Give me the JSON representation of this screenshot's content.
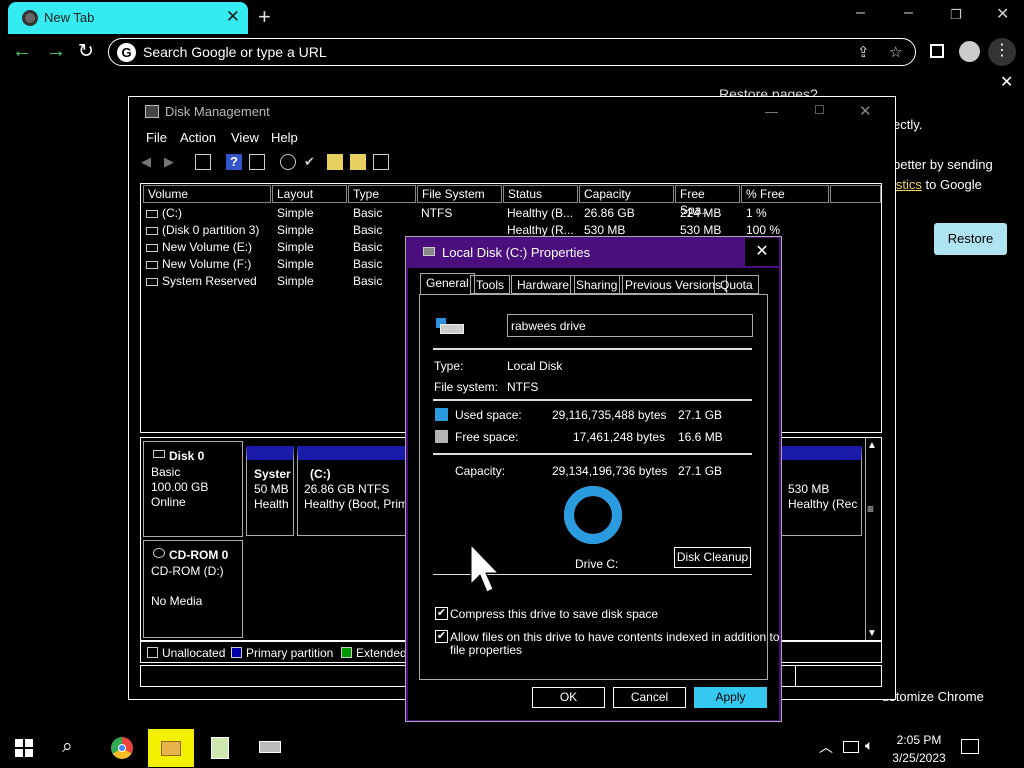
{
  "browser": {
    "tab_title": "New Tab",
    "omnibox_placeholder": "Search Google or type a URL",
    "win_min": "–",
    "win_restore": "❐",
    "win_close": "✕"
  },
  "restore_bubble": {
    "title": "Restore pages?",
    "line1": "ectly.",
    "line2": "better by sending",
    "line3_link": "istics",
    "line3_rest": " to Google",
    "button": "Restore"
  },
  "customize_chrome": "ustomize Chrome",
  "disk_mgmt": {
    "title": "Disk Management",
    "menu": [
      "File",
      "Action",
      "View",
      "Help"
    ],
    "columns": [
      "Volume",
      "Layout",
      "Type",
      "File System",
      "Status",
      "Capacity",
      "Free Spa...",
      "% Free"
    ],
    "volumes": [
      {
        "volume": "(C:)",
        "layout": "Simple",
        "type": "Basic",
        "fs": "NTFS",
        "status": "Healthy (B...",
        "capacity": "26.86 GB",
        "free": "224 MB",
        "pct": "1 %"
      },
      {
        "volume": "(Disk 0 partition 3)",
        "layout": "Simple",
        "type": "Basic",
        "fs": "",
        "status": "Healthy (R...",
        "capacity": "530 MB",
        "free": "530 MB",
        "pct": "100 %"
      },
      {
        "volume": "New Volume (E:)",
        "layout": "Simple",
        "type": "Basic",
        "fs": "",
        "status": "",
        "capacity": "",
        "free": "",
        "pct": ""
      },
      {
        "volume": "New Volume (F:)",
        "layout": "Simple",
        "type": "Basic",
        "fs": "",
        "status": "",
        "capacity": "",
        "free": "",
        "pct": ""
      },
      {
        "volume": "System Reserved",
        "layout": "Simple",
        "type": "Basic",
        "fs": "",
        "status": "",
        "capacity": "",
        "free": "",
        "pct": ""
      }
    ],
    "disk0": {
      "name": "Disk 0",
      "kind": "Basic",
      "size": "100.00 GB",
      "state": "Online"
    },
    "disk0_parts": [
      {
        "name": "Syster",
        "size": "50 MB",
        "status": "Health"
      },
      {
        "name": "(C:)",
        "size": "26.86 GB NTFS",
        "status": "Healthy (Boot, Prim"
      },
      {
        "name": "",
        "size": "530 MB",
        "status": "Healthy (Rec"
      }
    ],
    "cdrom": {
      "name": "CD-ROM 0",
      "kind": "CD-ROM (D:)",
      "state": "No Media"
    },
    "legend": [
      {
        "label": "Unallocated",
        "color": "#000000"
      },
      {
        "label": "Primary partition",
        "color": "#0000a8"
      },
      {
        "label": "Extended",
        "color": "#009a00"
      }
    ]
  },
  "props": {
    "title": "Local Disk (C:) Properties",
    "tabs": [
      "General",
      "Tools",
      "Hardware",
      "Sharing",
      "Previous Versions",
      "Quota"
    ],
    "drive_name": "rabwees drive",
    "type_label": "Type:",
    "type_value": "Local Disk",
    "fs_label": "File system:",
    "fs_value": "NTFS",
    "used_label": "Used space:",
    "used_bytes": "29,116,735,488 bytes",
    "used_gb": "27.1 GB",
    "free_label": "Free space:",
    "free_bytes": "17,461,248 bytes",
    "free_gb": "16.6 MB",
    "cap_label": "Capacity:",
    "cap_bytes": "29,134,196,736 bytes",
    "cap_gb": "27.1 GB",
    "used_fraction": 0.9994,
    "drive_caption": "Drive C:",
    "cleanup": "Disk Cleanup",
    "compress": "Compress this drive to save disk space",
    "index_line1": "Allow files on this drive to have contents indexed in addition to",
    "index_line2": "file properties",
    "ok": "OK",
    "cancel": "Cancel",
    "apply": "Apply",
    "used_color": "#2b9be0",
    "free_color": "#b3b3b3"
  },
  "taskbar": {
    "time": "2:05 PM",
    "date": "3/25/2023"
  }
}
